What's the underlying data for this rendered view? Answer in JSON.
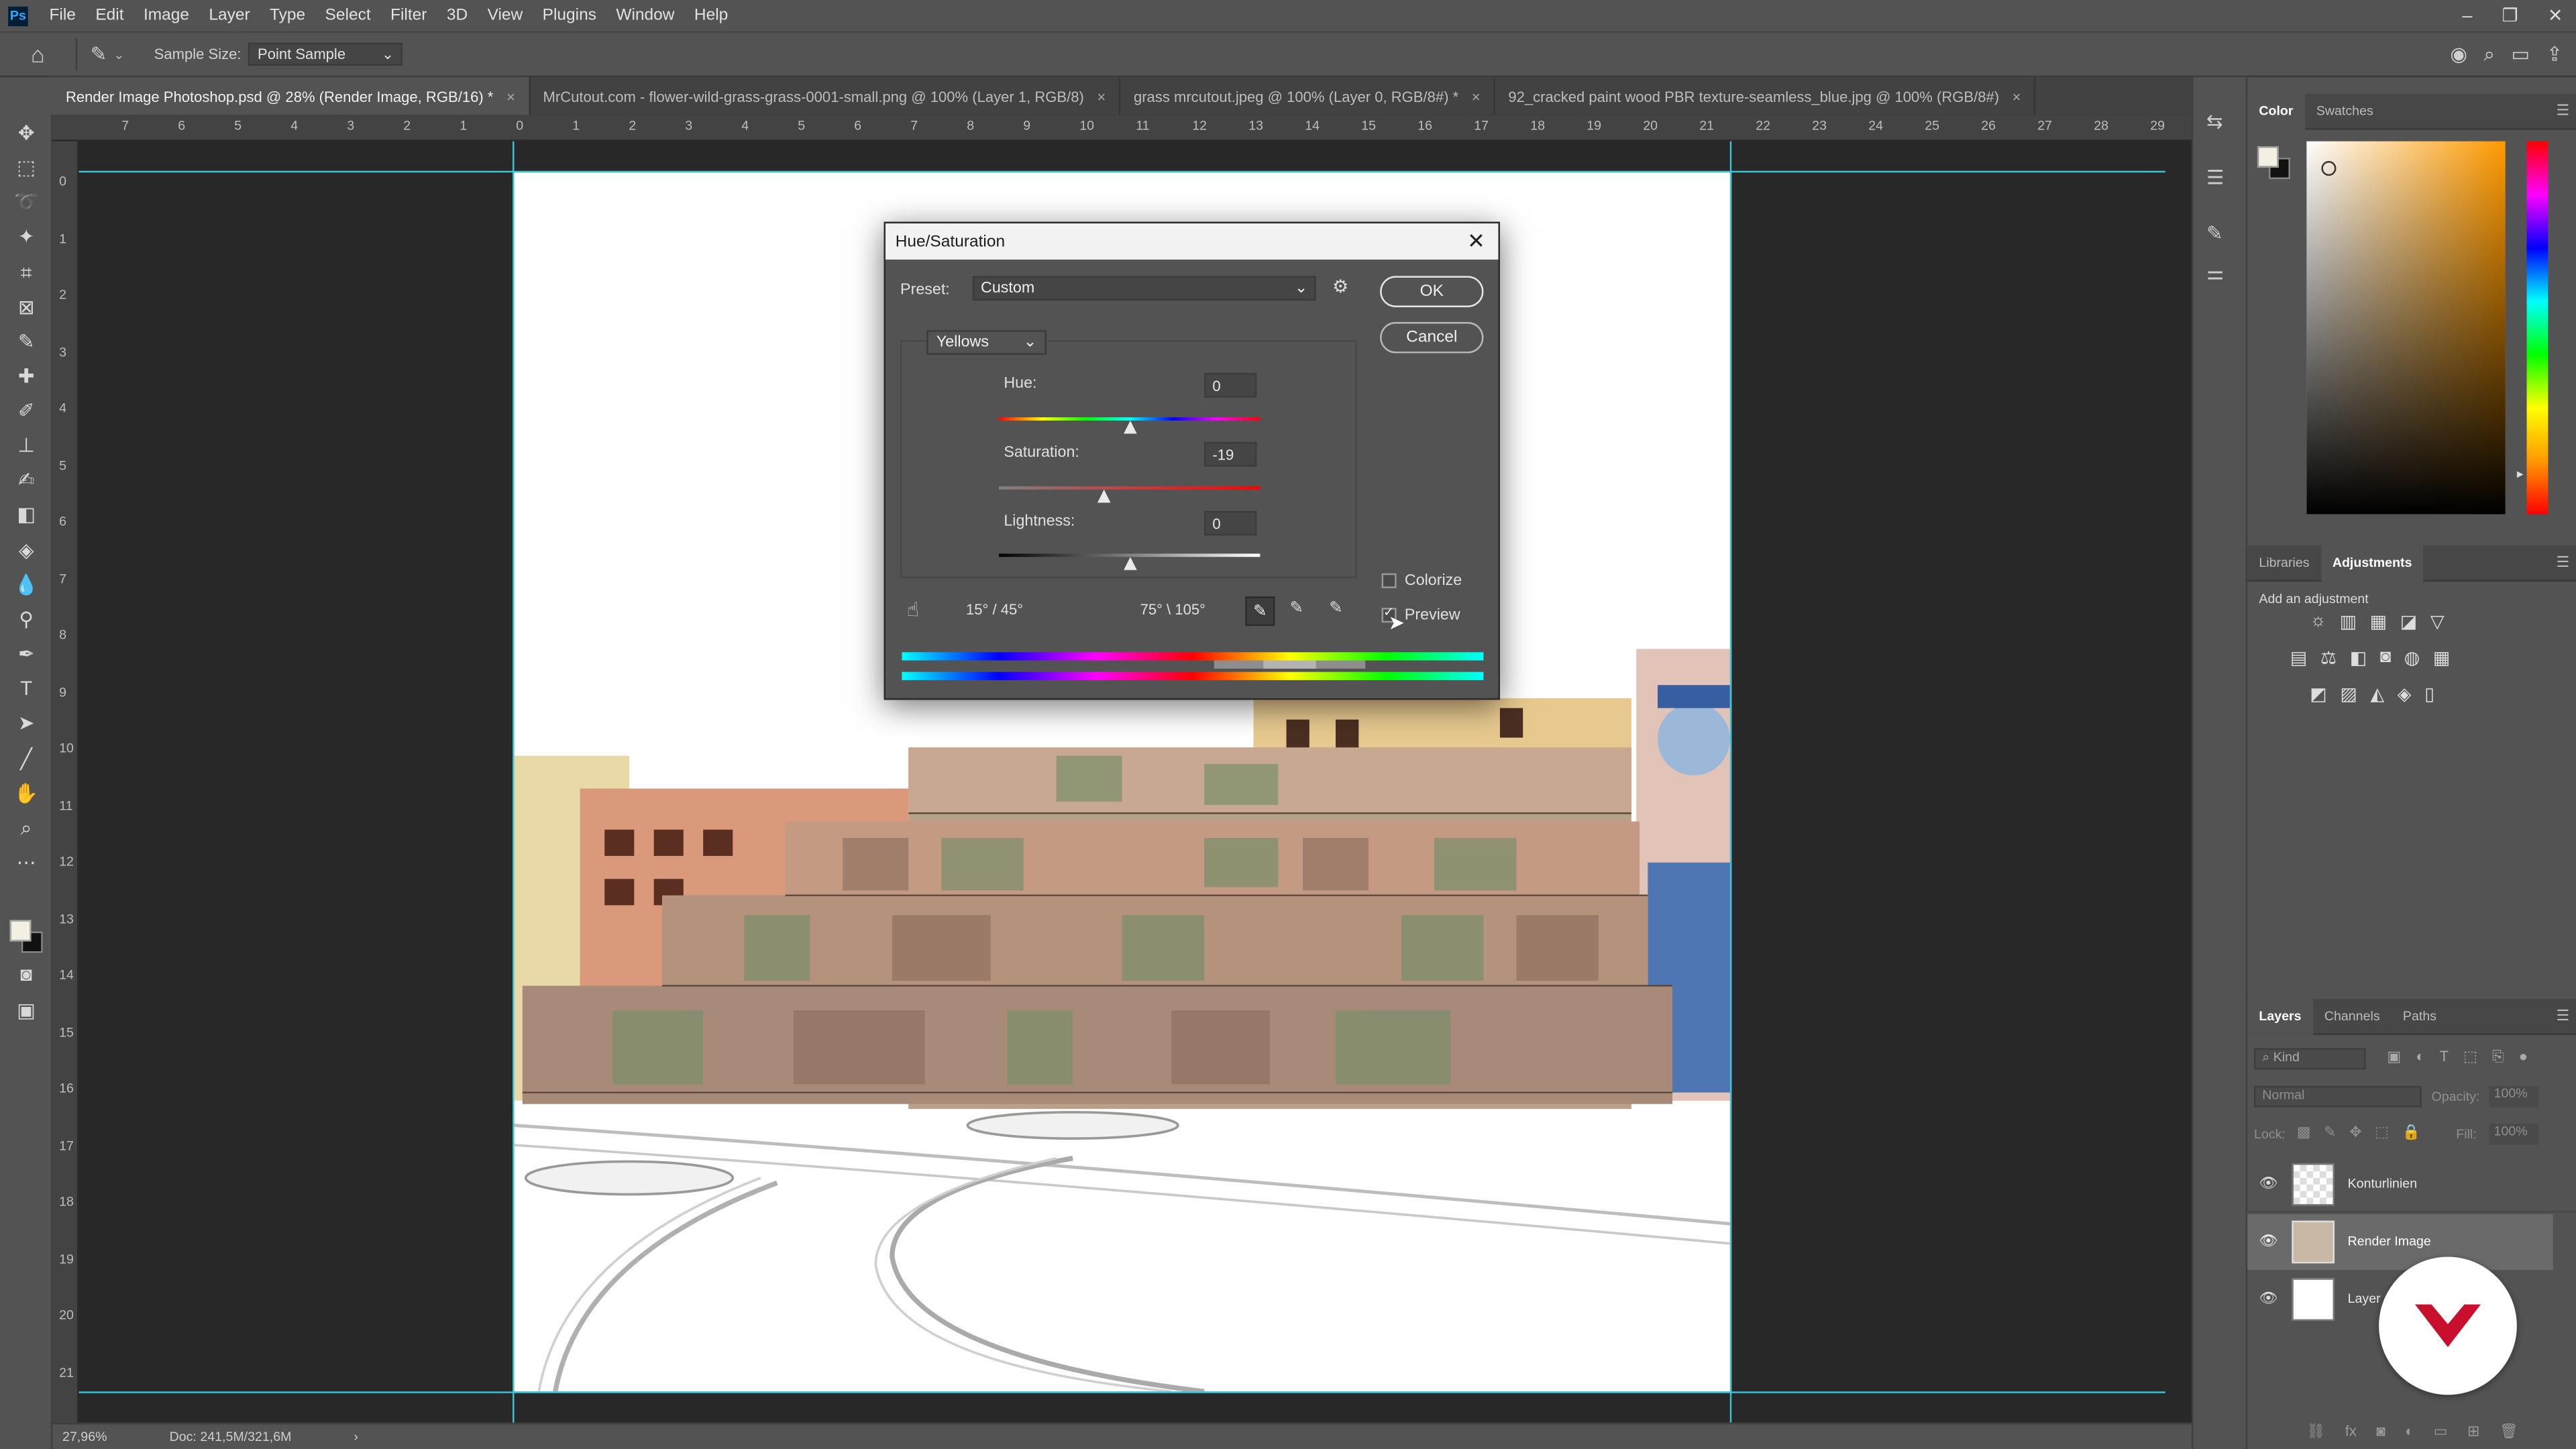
{
  "app": {
    "logo_text": "Ps",
    "menus": [
      "File",
      "Edit",
      "Image",
      "Layer",
      "Type",
      "Select",
      "Filter",
      "3D",
      "View",
      "Plugins",
      "Window",
      "Help"
    ]
  },
  "options_bar": {
    "sample_size_label": "Sample Size:",
    "sample_size_value": "Point Sample"
  },
  "tabs": [
    {
      "label": "Render Image Photoshop.psd @ 28% (Render Image, RGB/16) *",
      "active": true
    },
    {
      "label": "MrCutout.com - flower-wild-grass-grass-0001-small.png @ 100% (Layer 1, RGB/8)",
      "active": false
    },
    {
      "label": "grass mrcutout.jpeg @ 100% (Layer 0, RGB/8#) *",
      "active": false
    },
    {
      "label": "92_cracked paint wood PBR texture-seamless_blue.jpg @ 100% (RGB/8#)",
      "active": false
    }
  ],
  "ruler_h_ticks": [
    "7",
    "6",
    "5",
    "4",
    "3",
    "2",
    "1",
    "0",
    "1",
    "2",
    "3",
    "4",
    "5",
    "6",
    "7",
    "8",
    "9",
    "10",
    "11",
    "12",
    "13",
    "14",
    "15",
    "16",
    "17",
    "18",
    "19",
    "20",
    "21",
    "22",
    "23",
    "24",
    "25",
    "26",
    "27",
    "28",
    "29"
  ],
  "ruler_v_ticks": [
    "0",
    "1",
    "2",
    "3",
    "4",
    "5",
    "6",
    "7",
    "8",
    "9",
    "10",
    "11",
    "12",
    "13",
    "14",
    "15",
    "16",
    "17",
    "18",
    "19",
    "20",
    "21"
  ],
  "status": {
    "zoom": "27,96%",
    "doc": "Doc: 241,5M/321,6M",
    "arrow": "›"
  },
  "dialog": {
    "title": "Hue/Saturation",
    "preset_label": "Preset:",
    "preset_value": "Custom",
    "ok_label": "OK",
    "cancel_label": "Cancel",
    "channel_value": "Yellows",
    "hue_label": "Hue:",
    "hue_value": "0",
    "saturation_label": "Saturation:",
    "saturation_value": "-19",
    "lightness_label": "Lightness:",
    "lightness_value": "0",
    "colorize_label": "Colorize",
    "preview_label": "Preview",
    "range_left": "15° / 45°",
    "range_right": "75° \\ 105°",
    "hue_level": 0.5,
    "saturation_level": 0.405,
    "lightness_level": 0.5,
    "colorize_checked": false,
    "preview_checked": true
  },
  "color_panel": {
    "tabs": [
      "Color",
      "Swatches"
    ],
    "fg_color": "#f3efe3",
    "bg_color": "#111111",
    "hue_color": "#ff9a00"
  },
  "adjustments_panel": {
    "tabs": [
      "Libraries",
      "Adjustments"
    ],
    "add_label": "Add an adjustment"
  },
  "layers_panel": {
    "tabs": [
      "Layers",
      "Channels",
      "Paths"
    ],
    "kind_label": "Kind",
    "blend_mode": "Normal",
    "opacity_label": "Opacity:",
    "opacity_value": "100%",
    "lock_label": "Lock:",
    "fill_label": "Fill:",
    "fill_value": "100%",
    "layers": [
      {
        "name": "Konturlinien",
        "selected": false
      },
      {
        "name": "Render Image",
        "selected": true
      },
      {
        "name": "Layer",
        "selected": false
      }
    ]
  },
  "colors": {
    "accent": "#31a8ff",
    "guide": "#3cc6d9",
    "overlay_logo": "#c8102e"
  }
}
